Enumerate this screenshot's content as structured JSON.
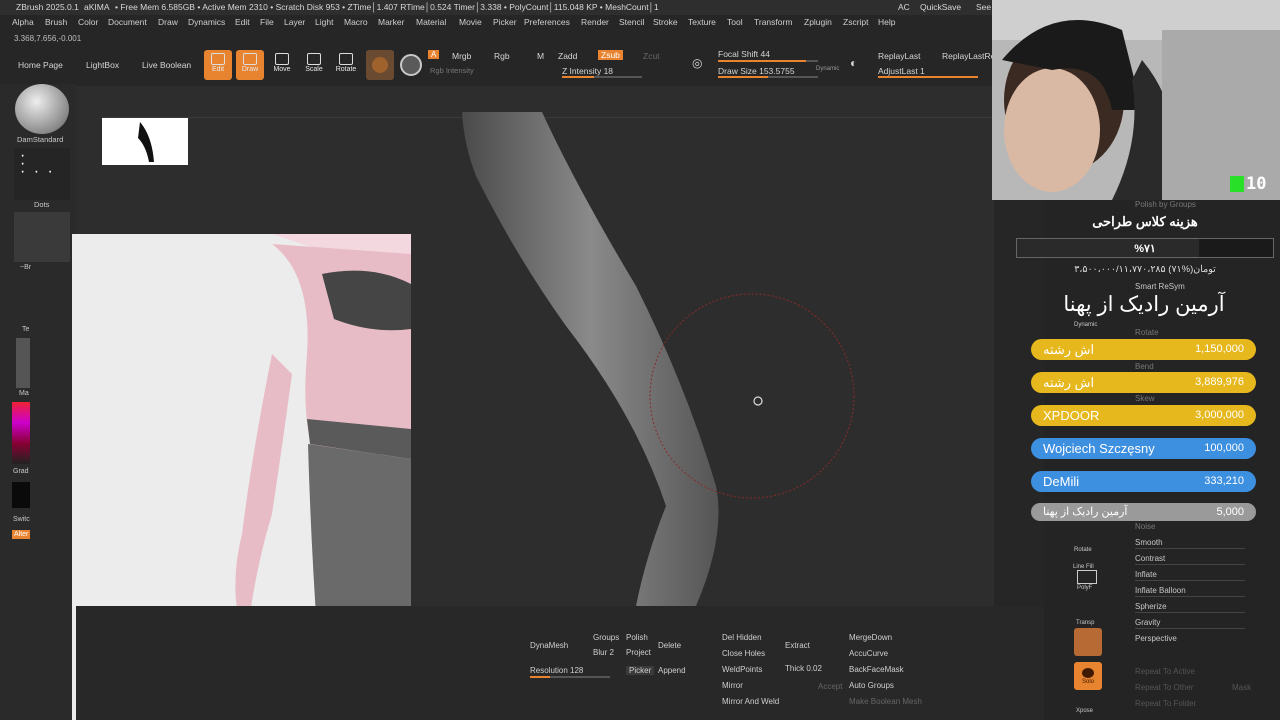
{
  "menubar": {
    "app": "ZBrush 2025.0.1",
    "user": "aKIMA",
    "status": "• Free Mem 6.585GB • Active Mem 2310 • Scratch Disk 953 • ZTime│1.407 RTime│0.524 Timer│3.338 • PolyCount│115.048 KP • MeshCount│1",
    "ac": "AC",
    "quicksave": "QuickSave",
    "see": "See"
  },
  "menus": [
    "Alpha",
    "Brush",
    "Color",
    "Document",
    "Draw",
    "Dynamics",
    "Edit",
    "File",
    "Layer",
    "Light",
    "Macro",
    "Marker",
    "Material",
    "Movie",
    "Picker",
    "Preferences",
    "Render",
    "Stencil",
    "Stroke",
    "Texture",
    "Tool",
    "Transform",
    "Zplugin",
    "Zscript",
    "Help"
  ],
  "coords": "3.368,7.656,-0.001",
  "toolbar": {
    "home": "Home Page",
    "lightbox": "LightBox",
    "liveboolean": "Live Boolean",
    "edit": "Edit",
    "draw": "Draw",
    "move": "Move",
    "scale": "Scale",
    "rotate": "Rotate",
    "a": "A",
    "mrgb": "Mrgb",
    "rgb": "Rgb",
    "m": "M",
    "zadd": "Zadd",
    "zsub": "Zsub",
    "zcut": "Zcut",
    "rgb_intensity": "Rgb Intensity",
    "z_intensity": "Z Intensity 18",
    "focal_shift": "Focal Shift 44",
    "draw_size": "Draw Size 153.5755",
    "dynamic": "Dynamic",
    "replay_last": "ReplayLast",
    "replay_last_rel": "ReplayLastRel",
    "adjust_last": "AdjustLast 1"
  },
  "shelf": {
    "brush": "DamStandard",
    "stroke": "Dots",
    "alpha": "~Br",
    "texture": "Te",
    "material": "Ma",
    "gradient": "Grad",
    "switch": "Switc",
    "alternate": "Alter"
  },
  "bottom": {
    "dynamesh": "DynaMesh",
    "groups": "Groups",
    "polish": "Polish",
    "blur": "Blur 2",
    "project": "Project",
    "resolution": "Resolution 128",
    "picker": "Picker",
    "delete": "Delete",
    "append": "Append",
    "del_hidden": "Del Hidden",
    "close_holes": "Close Holes",
    "weld_points": "WeldPoints",
    "mirror": "Mirror",
    "mirror_weld": "Mirror And Weld",
    "extract": "Extract",
    "thick": "Thick 0.02",
    "accept": "Accept",
    "merge_down": "MergeDown",
    "accu_curve": "AccuCurve",
    "backface_mask": "BackFaceMask",
    "auto_groups": "Auto Groups",
    "make_boolean": "Make Boolean Mesh"
  },
  "right": {
    "polish_groups": "Polish by Groups",
    "smart_resym": "Smart ReSym",
    "dynamic": "Dynamic",
    "rotate": "Rotate",
    "bend": "Bend",
    "skew": "Skew",
    "noise": "Noise",
    "sliders": [
      "Smooth",
      "Contrast",
      "Inflate",
      "Inflate Balloon",
      "Spherize",
      "Gravity",
      "Perspective"
    ],
    "repeat_active": "Repeat To Active",
    "repeat_other": "Repeat To Other",
    "mask": "Mask",
    "repeat_folder": "Repeat To Folder",
    "icons": [
      "Rotate",
      "Line Fill",
      "PolyF",
      "Transp",
      "Solo",
      "Xpose"
    ]
  },
  "overlay": {
    "title": "هزینه کلاس طراحی",
    "percent": "%۷۱",
    "progress": "۳،۵۰۰،۰۰۰/۱۱،۷۷۰،۲۸۵ تومان(%۷۱)",
    "progress_fraction": 0.71,
    "headline": "آرمین رادیک از پهنا",
    "donations": [
      {
        "name": "اش رشته",
        "amount": "1,150,000",
        "color": "#e6b81e"
      },
      {
        "name": "اش رشته",
        "amount": "3,889,976",
        "color": "#e6b81e"
      },
      {
        "name": "XPDOOR",
        "amount": "3,000,000",
        "color": "#e6b81e"
      },
      {
        "name": "Wojciech Szczęsny",
        "amount": "100,000",
        "color": "#3d8fe0"
      },
      {
        "name": "DeMili",
        "amount": "333,210",
        "color": "#3d8fe0"
      },
      {
        "name": "آرمین رادیک از پهنا",
        "amount": "5,000",
        "color": "#9a9a9a"
      }
    ],
    "kick_label": "10"
  },
  "colors": {
    "accent": "#e8832f",
    "gold": "#e6b81e",
    "blue": "#3d8fe0"
  }
}
